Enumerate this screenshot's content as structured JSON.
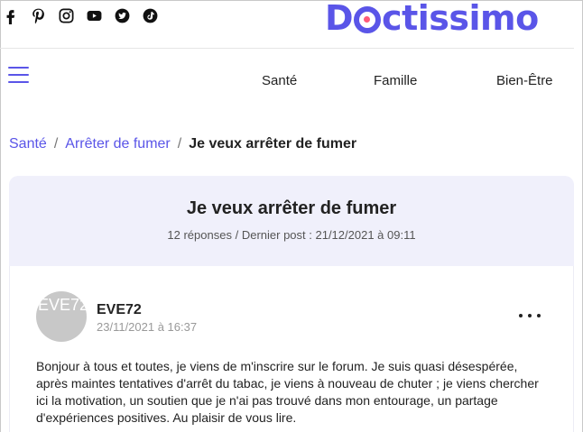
{
  "social": [
    "facebook-icon",
    "pinterest-icon",
    "instagram-icon",
    "youtube-icon",
    "twitter-icon",
    "tiktok-icon"
  ],
  "brand": {
    "logo_prefix": "D",
    "logo_suffix": "ctissimo",
    "color": "#5a55e8",
    "accent": "#ff5a7a"
  },
  "nav": {
    "items": [
      {
        "label": "Santé"
      },
      {
        "label": "Famille"
      },
      {
        "label": "Bien-Être"
      }
    ]
  },
  "breadcrumb": {
    "items": [
      {
        "label": "Santé"
      },
      {
        "label": "Arrêter de fumer"
      }
    ],
    "separator": "/",
    "current": "Je veux arrêter de fumer"
  },
  "thread": {
    "title": "Je veux arrêter de fumer",
    "replies": "12 réponses",
    "meta_separator": "/",
    "last_post": "Dernier post : 21/12/2021 à 09:11",
    "header_bg": "#f0f0fb"
  },
  "post": {
    "avatar_text": "EVE72",
    "author": "EVE72",
    "date": "23/11/2021 à 16:37",
    "body": "Bonjour à tous et toutes, je viens de m'inscrire sur le forum. Je suis quasi désespérée, après maintes tentatives d'arrêt du tabac, je viens à nouveau de chuter ; je viens chercher ici la motivation, un soutien que je n'ai pas trouvé dans mon entourage, un partage d'expériences positives. Au plaisir de vous lire."
  }
}
